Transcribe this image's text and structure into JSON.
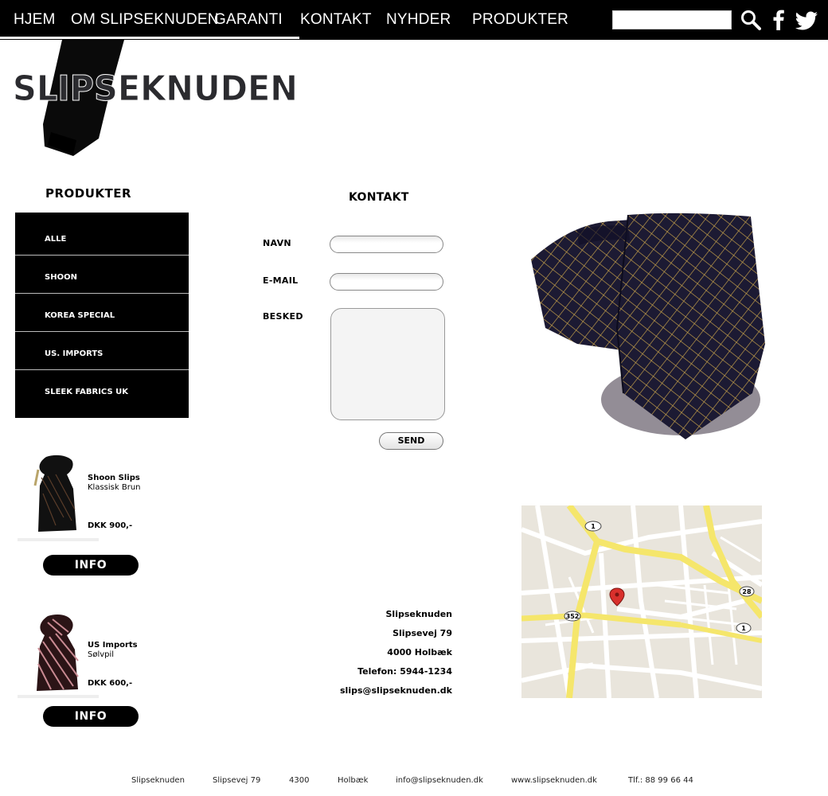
{
  "nav": {
    "items": [
      "HJEM",
      "OM SLIPSEKNUDEN",
      "GARANTI",
      "KONTAKT",
      "NYHDER",
      "PRODUKTER"
    ],
    "search_placeholder": ""
  },
  "logo": {
    "text": "SLIPSEKNUDEN"
  },
  "sidebar": {
    "title": "PRODUKTER",
    "items": [
      "ALLE",
      "SHOON",
      "KOREA SPECIAL",
      "US. IMPORTS",
      "SLEEK FABRICS UK"
    ]
  },
  "products": [
    {
      "name": "Shoon Slips",
      "subtitle": "Klassisk Brun",
      "price": "DKK 900,-",
      "button": "INFO"
    },
    {
      "name": "US Imports",
      "subtitle": "Sølvpil",
      "price": "DKK 600,-",
      "button": "INFO"
    }
  ],
  "contact": {
    "title": "KONTAKT",
    "name_label": "NAVN",
    "email_label": "E-MAIL",
    "message_label": "BESKED",
    "send_label": "SEND"
  },
  "address": {
    "lines": [
      "Slipseknuden",
      "Slipsevej 79",
      "4000 Holbæk",
      "Telefon: 5944-1234",
      "slips@slipseknuden.dk"
    ]
  },
  "map": {
    "road_labels": [
      "1",
      "352",
      "28",
      "1"
    ]
  },
  "footer": {
    "items": [
      "Slipseknuden",
      "Slipsevej 79",
      "4300",
      "Holbæk",
      "info@slipseknuden.dk",
      "www.slipseknuden.dk",
      "Tlf.: 88 99 66 44"
    ]
  },
  "colors": {
    "nav_bg": "#000000",
    "map_road": "#f5e66b",
    "map_bg": "#e9e5dc"
  },
  "icons": [
    "search-icon",
    "facebook-icon",
    "twitter-icon"
  ]
}
